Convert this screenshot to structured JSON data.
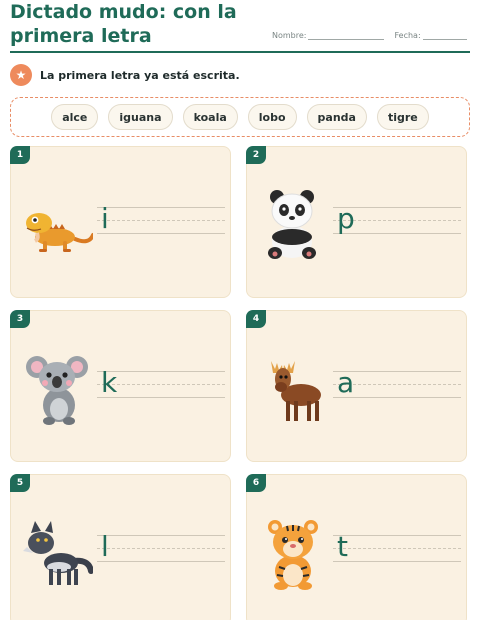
{
  "header": {
    "title": "Dictado mudo: con la primera letra",
    "name_label": "Nombre:",
    "date_label": "Fecha:"
  },
  "instruction": {
    "icon": "star-icon",
    "text": "La primera letra ya está escrita."
  },
  "word_bank": [
    "alce",
    "iguana",
    "koala",
    "lobo",
    "panda",
    "tigre"
  ],
  "cards": [
    {
      "number": "1",
      "animal": "iguana-illustration",
      "letter": "i"
    },
    {
      "number": "2",
      "animal": "panda-illustration",
      "letter": "p"
    },
    {
      "number": "3",
      "animal": "koala-illustration",
      "letter": "k"
    },
    {
      "number": "4",
      "animal": "moose-illustration",
      "letter": "a"
    },
    {
      "number": "5",
      "animal": "wolf-illustration",
      "letter": "l"
    },
    {
      "number": "6",
      "animal": "tiger-illustration",
      "letter": "t"
    }
  ],
  "colors": {
    "accent": "#1f6b58",
    "orange": "#ee8a5c",
    "card_bg": "#faf1e2"
  }
}
